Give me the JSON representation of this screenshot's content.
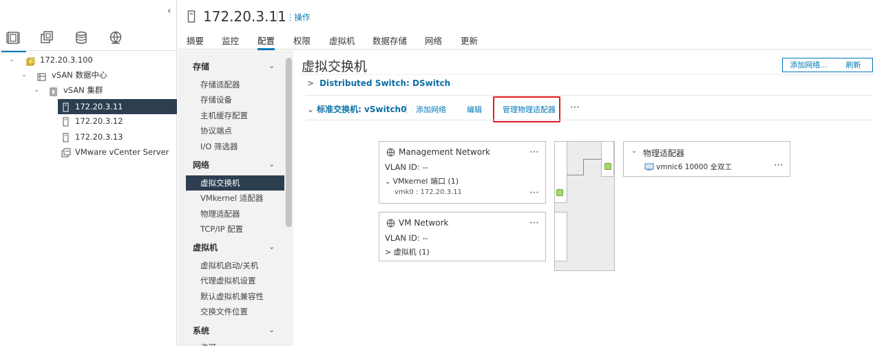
{
  "host": {
    "title": "172.20.3.11",
    "actions_label": "操作"
  },
  "tabs": [
    "摘要",
    "监控",
    "配置",
    "权限",
    "虚拟机",
    "数据存储",
    "网络",
    "更新"
  ],
  "active_tab": "配置",
  "navigator": {
    "tree": [
      {
        "label": "172.20.3.100",
        "icon": "vcenter-icon"
      },
      {
        "label": "vSAN 数据中心",
        "icon": "datacenter-icon"
      },
      {
        "label": "vSAN 集群",
        "icon": "cluster-icon"
      },
      {
        "label": "172.20.3.11",
        "icon": "host-icon",
        "selected": true
      },
      {
        "label": "172.20.3.12",
        "icon": "host-icon"
      },
      {
        "label": "172.20.3.13",
        "icon": "host-icon"
      },
      {
        "label": "VMware vCenter Server",
        "icon": "vm-icon"
      }
    ],
    "tab_icons": [
      "hosts-clusters-icon",
      "vms-templates-icon",
      "storage-icon",
      "networking-icon"
    ]
  },
  "config_menu": {
    "sections": [
      {
        "title": "存储",
        "items": [
          "存储适配器",
          "存储设备",
          "主机缓存配置",
          "协议端点",
          "I/O 筛选器"
        ]
      },
      {
        "title": "网络",
        "items": [
          "虚拟交换机",
          "VMkernel 适配器",
          "物理适配器",
          "TCP/IP 配置"
        ]
      },
      {
        "title": "虚拟机",
        "items": [
          "虚拟机启动/关机",
          "代理虚拟机设置",
          "默认虚拟机兼容性",
          "交换文件位置"
        ]
      },
      {
        "title": "系统",
        "items": [
          "许可"
        ]
      }
    ],
    "selected_item": "虚拟交换机"
  },
  "content": {
    "title": "虚拟交换机",
    "add_network_button": "添加网络...",
    "refresh_button": "刷新",
    "distributed_switch": "Distributed Switch: DSwitch",
    "standard_switch_prefix": "标准交换机: ",
    "standard_switch_name": "vSwitch0",
    "switch_actions": {
      "add_network": "添加网络",
      "edit": "编辑",
      "manage_physical": "管理物理适配器",
      "more": "⋯"
    },
    "port_groups": [
      {
        "name": "Management Network",
        "vlan": "VLAN ID: --",
        "sub_label": "VMkernel 端口 (1)",
        "sub_expanded": true,
        "sub_item": "vmk0 : 172.20.3.11"
      },
      {
        "name": "VM Network",
        "vlan": "VLAN ID: --",
        "sub_label": "虚拟机 (1)",
        "sub_expanded": false
      }
    ],
    "physical_adapters": {
      "title": "物理适配器",
      "nic": "vmnic6 10000 全双工"
    }
  },
  "colors": {
    "accent": "#0079b8",
    "selected_bg": "#2c3e50",
    "highlight": "#e0191e",
    "port": "#a8d86e"
  }
}
